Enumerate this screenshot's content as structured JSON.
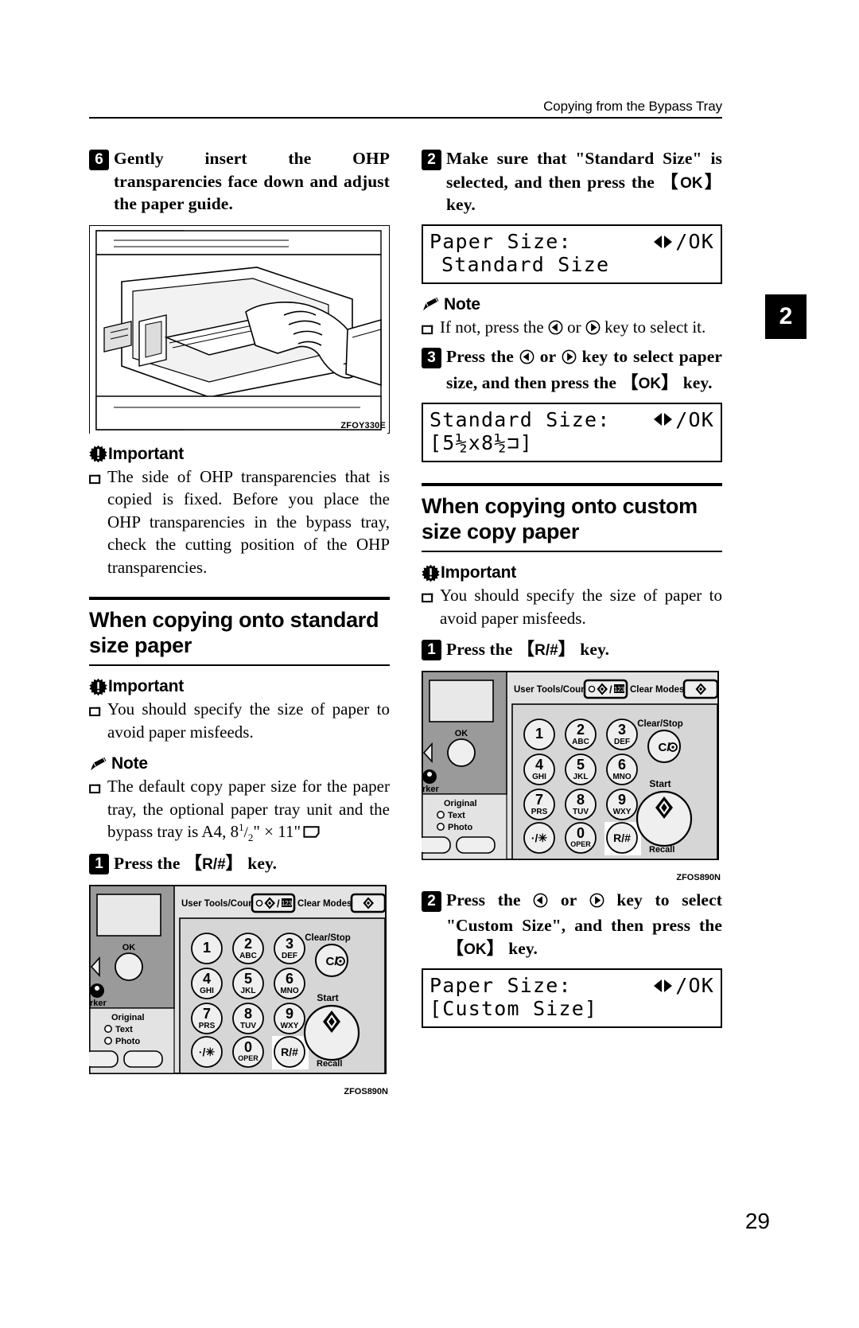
{
  "header": {
    "running_title": "Copying from the Bypass Tray",
    "chapter_marker": "2",
    "page_number": "29"
  },
  "left_column": {
    "step6": {
      "num": "6",
      "text": "Gently insert the OHP transparencies face down and adjust the paper guide."
    },
    "figure_bypass": {
      "code": "ZFOY330E",
      "alt": "bypass-tray-insert-illustration"
    },
    "important1": {
      "label": "Important",
      "icon": "important-burst-icon",
      "bullet": "The side of OHP transparencies that is copied is fixed. Before you place the OHP transparencies in the bypass tray, check the cutting position of the OHP transparencies."
    },
    "section": {
      "title_line1": "When copying onto standard",
      "title_line2": "size paper"
    },
    "important2": {
      "label": "Important",
      "icon": "important-burst-icon",
      "bullet": "You should specify the size of paper to avoid paper misfeeds."
    },
    "note1": {
      "label": "Note",
      "icon": "note-pencil-icon",
      "bullet_pre": "The default copy paper size for the paper tray, the optional paper tray unit and the bypass tray is A4,",
      "bullet_size_whole": "8",
      "bullet_size_num": "1",
      "bullet_size_den": "2",
      "bullet_size_rest": "\" × 11\""
    },
    "step1": {
      "num": "1",
      "text_pre": "Press the ",
      "keycap": "R/#",
      "text_post": " key."
    },
    "figure_panel": {
      "code": "ZFOS890N",
      "alt": "operation-panel-illustration"
    }
  },
  "right_column": {
    "step2": {
      "num": "2",
      "text_pre": "Make sure that \"Standard Size\" is selected, and then press the ",
      "keycap": "OK",
      "text_post": " key."
    },
    "lcd1": {
      "line1_left": "Paper Size:",
      "line1_right": "/OK",
      "line2": "Standard Size"
    },
    "note2": {
      "label": "Note",
      "icon": "note-pencil-icon",
      "bullet_pre": "If not, press the ",
      "bullet_mid": " or ",
      "bullet_post": " key to select it."
    },
    "step3": {
      "num": "3",
      "text_pre": "Press the ",
      "text_mid": " or ",
      "text_post": " key to select paper size, and then press the ",
      "keycap": "OK",
      "text_end": " key."
    },
    "lcd2": {
      "line1_left": "Standard Size:",
      "line1_right": "/OK",
      "line2": "[5½x8½⊐]"
    },
    "section": {
      "title_line1": "When copying onto custom",
      "title_line2": "size copy paper"
    },
    "important3": {
      "label": "Important",
      "icon": "important-burst-icon",
      "bullet": "You should specify the size of paper to avoid paper misfeeds."
    },
    "step1": {
      "num": "1",
      "text_pre": "Press the ",
      "keycap": "R/#",
      "text_post": " key."
    },
    "figure_panel": {
      "code": "ZFOS890N",
      "alt": "operation-panel-illustration"
    },
    "step2b": {
      "num": "2",
      "text_pre": "Press the ",
      "text_mid": " or ",
      "text_post": " key to select \"Custom Size\", and then press the ",
      "keycap": "OK",
      "text_end": " key."
    },
    "lcd3": {
      "line1_left": "Paper Size:",
      "line1_right": "/OK",
      "line2": "[Custom Size]"
    }
  },
  "control_panel": {
    "labels": {
      "user_tools_counter": "User Tools/Counter",
      "clear_modes": "Clear Modes",
      "clear_stop": "Clear/Stop",
      "start": "Start",
      "original": "Original",
      "text": "Text",
      "photo": "Photo",
      "ok": "OK",
      "recall": "Recall",
      "marker": "rker",
      "clear_stop_glyph": "C/⊙"
    },
    "keys": [
      {
        "digit": "1",
        "letters": ""
      },
      {
        "digit": "2",
        "letters": "ABC"
      },
      {
        "digit": "3",
        "letters": "DEF"
      },
      {
        "digit": "4",
        "letters": "GHI"
      },
      {
        "digit": "5",
        "letters": "JKL"
      },
      {
        "digit": "6",
        "letters": "MNO"
      },
      {
        "digit": "7",
        "letters": "PRS"
      },
      {
        "digit": "8",
        "letters": "TUV"
      },
      {
        "digit": "9",
        "letters": "WXY"
      },
      {
        "digit": "·/✳",
        "letters": ""
      },
      {
        "digit": "0",
        "letters": "OPER"
      },
      {
        "digit": "R/#",
        "letters": ""
      }
    ]
  },
  "colors": {
    "ink": "#000000",
    "panel_light": "#e3e3e3",
    "panel_mid": "#c9c9c9",
    "panel_dark": "#9a9a9a",
    "paper": "#ffffff"
  }
}
